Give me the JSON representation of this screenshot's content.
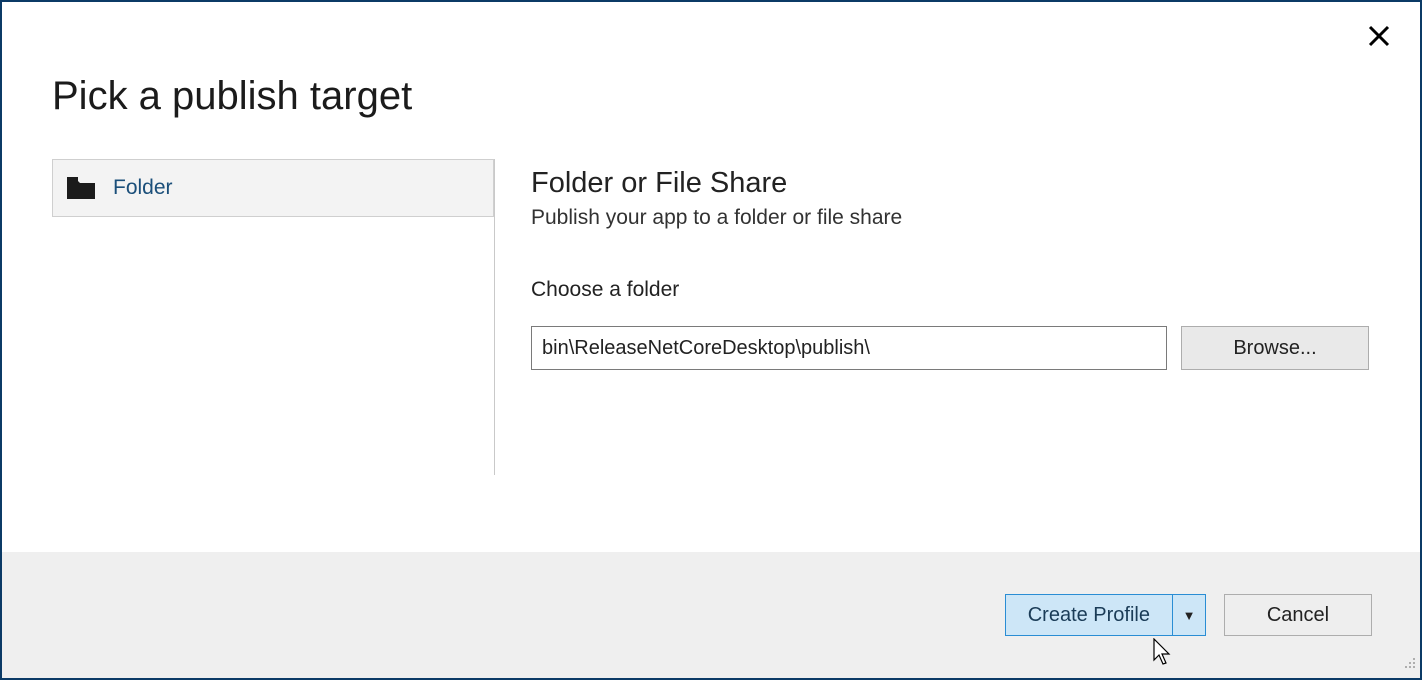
{
  "dialog": {
    "title": "Pick a publish target"
  },
  "targets": {
    "items": [
      {
        "label": "Folder"
      }
    ]
  },
  "details": {
    "heading": "Folder or File Share",
    "subheading": "Publish your app to a folder or file share",
    "field_label": "Choose a folder",
    "path_value": "bin\\ReleaseNetCoreDesktop\\publish\\",
    "browse_label": "Browse..."
  },
  "footer": {
    "primary_label": "Create Profile",
    "cancel_label": "Cancel"
  }
}
